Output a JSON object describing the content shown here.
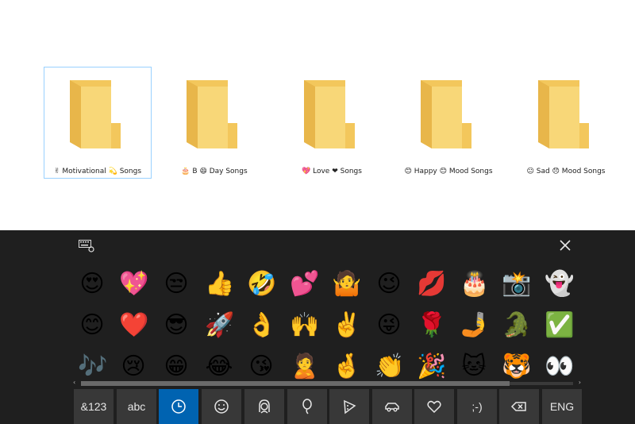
{
  "folders": [
    {
      "name": "✌ Motivational 💫 Songs",
      "selected": true
    },
    {
      "name": "🎂 B 😄 Day Songs",
      "selected": false
    },
    {
      "name": "💖 Love ❤ Songs",
      "selected": false
    },
    {
      "name": "😊 Happy 😊 Mood Songs",
      "selected": false
    },
    {
      "name": "😐 Sad 😞 Mood Songs",
      "selected": false
    }
  ],
  "keyboard": {
    "emoji_rows": [
      [
        "😍",
        "💖",
        "😒",
        "👍",
        "🤣",
        "💕",
        "🤷",
        "😉",
        "💋",
        "🎂",
        "📸",
        "👻"
      ],
      [
        "😊",
        "❤️",
        "😎",
        "🚀",
        "👌",
        "🙌",
        "✌️",
        "😜",
        "🌹",
        "🤳",
        "🐊",
        "✅"
      ],
      [
        "🎶",
        "😢",
        "😁",
        "😂",
        "😘",
        "🙎",
        "🤞",
        "👏",
        "🎉",
        "🐱",
        "🐯",
        "👀"
      ]
    ],
    "keys": [
      {
        "label": "&123",
        "icon": "",
        "active": false
      },
      {
        "label": "abc",
        "icon": "",
        "active": false
      },
      {
        "label": "",
        "icon": "clock-icon",
        "active": true
      },
      {
        "label": "",
        "icon": "smiley-icon",
        "active": false
      },
      {
        "label": "",
        "icon": "person-icon",
        "active": false
      },
      {
        "label": "",
        "icon": "balloon-icon",
        "active": false
      },
      {
        "label": "",
        "icon": "pizza-icon",
        "active": false
      },
      {
        "label": "",
        "icon": "car-icon",
        "active": false
      },
      {
        "label": "",
        "icon": "heart-icon",
        "active": false
      },
      {
        "label": ";-)",
        "icon": "",
        "active": false
      },
      {
        "label": "",
        "icon": "backspace-icon",
        "active": false
      },
      {
        "label": "ENG",
        "icon": "",
        "active": false
      }
    ],
    "accent_color": "#0063b1"
  }
}
